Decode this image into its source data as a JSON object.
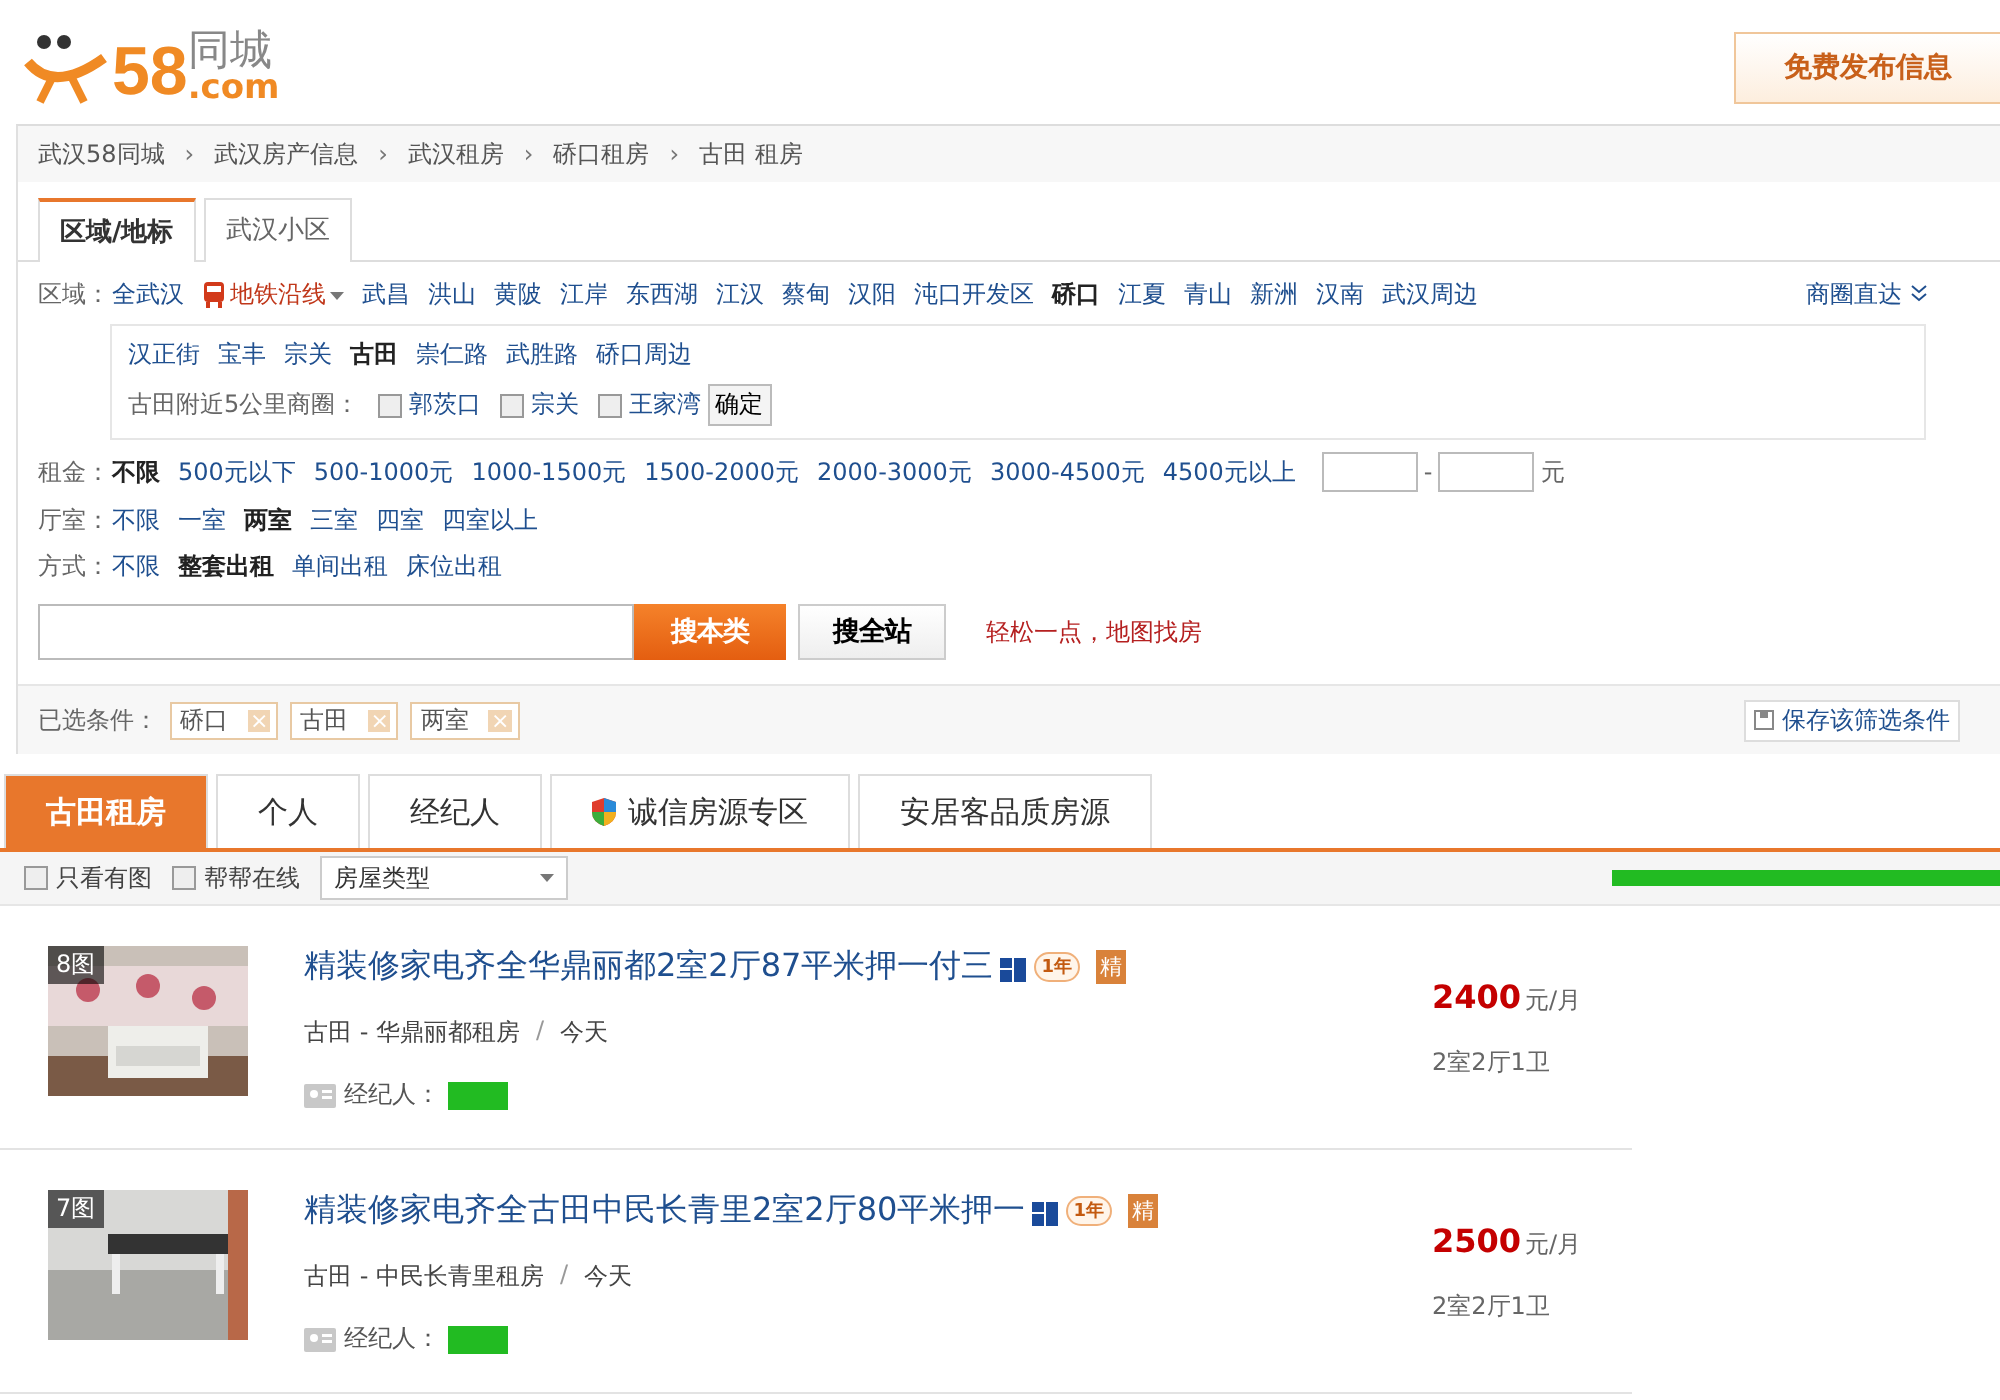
{
  "header": {
    "logo": {
      "number": "58",
      "domain": ".com",
      "name": "同城"
    },
    "publish_button": "免费发布信息"
  },
  "breadcrumb": [
    "武汉58同城",
    "武汉房产信息",
    "武汉租房",
    "硚口租房",
    "古田 租房"
  ],
  "breadcrumb_separator": "›",
  "filter_tabs": [
    {
      "label": "区域/地标",
      "selected": true
    },
    {
      "label": "武汉小区",
      "selected": false
    }
  ],
  "region": {
    "label": "区域：",
    "items": [
      {
        "label": "全武汉",
        "selected": false,
        "kind": "link"
      },
      {
        "label": "地铁沿线",
        "selected": false,
        "kind": "metro"
      },
      {
        "label": "武昌",
        "selected": false,
        "kind": "link"
      },
      {
        "label": "洪山",
        "selected": false,
        "kind": "link"
      },
      {
        "label": "黄陂",
        "selected": false,
        "kind": "link"
      },
      {
        "label": "江岸",
        "selected": false,
        "kind": "link"
      },
      {
        "label": "东西湖",
        "selected": false,
        "kind": "link"
      },
      {
        "label": "江汉",
        "selected": false,
        "kind": "link"
      },
      {
        "label": "蔡甸",
        "selected": false,
        "kind": "link"
      },
      {
        "label": "汉阳",
        "selected": false,
        "kind": "link"
      },
      {
        "label": "沌口开发区",
        "selected": false,
        "kind": "link"
      },
      {
        "label": "硚口",
        "selected": true,
        "kind": "link"
      },
      {
        "label": "江夏",
        "selected": false,
        "kind": "link"
      },
      {
        "label": "青山",
        "selected": false,
        "kind": "link"
      },
      {
        "label": "新洲",
        "selected": false,
        "kind": "link"
      },
      {
        "label": "汉南",
        "selected": false,
        "kind": "link"
      },
      {
        "label": "武汉周边",
        "selected": false,
        "kind": "link"
      }
    ],
    "shortcut": "商圈直达"
  },
  "subregion": {
    "items": [
      {
        "label": "汉正街",
        "selected": false
      },
      {
        "label": "宝丰",
        "selected": false
      },
      {
        "label": "宗关",
        "selected": false
      },
      {
        "label": "古田",
        "selected": true
      },
      {
        "label": "崇仁路",
        "selected": false
      },
      {
        "label": "武胜路",
        "selected": false
      },
      {
        "label": "硚口周边",
        "selected": false
      }
    ],
    "nearby_label": "古田附近5公里商圈：",
    "nearby": [
      {
        "label": "郭茨口",
        "checked": false
      },
      {
        "label": "宗关",
        "checked": false
      },
      {
        "label": "王家湾",
        "checked": false
      }
    ],
    "confirm": "确定"
  },
  "rent": {
    "label": "租金：",
    "items": [
      {
        "label": "不限",
        "selected": true
      },
      {
        "label": "500元以下",
        "selected": false
      },
      {
        "label": "500-1000元",
        "selected": false
      },
      {
        "label": "1000-1500元",
        "selected": false
      },
      {
        "label": "1500-2000元",
        "selected": false
      },
      {
        "label": "2000-3000元",
        "selected": false
      },
      {
        "label": "3000-4500元",
        "selected": false
      },
      {
        "label": "4500元以上",
        "selected": false
      }
    ],
    "range_dash": "-",
    "unit": "元"
  },
  "rooms": {
    "label": "厅室：",
    "items": [
      {
        "label": "不限",
        "selected": false
      },
      {
        "label": "一室",
        "selected": false
      },
      {
        "label": "两室",
        "selected": true
      },
      {
        "label": "三室",
        "selected": false
      },
      {
        "label": "四室",
        "selected": false
      },
      {
        "label": "四室以上",
        "selected": false
      }
    ]
  },
  "mode": {
    "label": "方式：",
    "items": [
      {
        "label": "不限",
        "selected": false
      },
      {
        "label": "整套出租",
        "selected": true
      },
      {
        "label": "单间出租",
        "selected": false
      },
      {
        "label": "床位出租",
        "selected": false
      }
    ]
  },
  "search": {
    "category_button": "搜本类",
    "site_button": "搜全站",
    "map_link": "轻松一点，地图找房"
  },
  "selected_conditions": {
    "label": "已选条件：",
    "tags": [
      "硚口",
      "古田",
      "两室"
    ],
    "remove": "×",
    "save": "保存该筛选条件"
  },
  "list_tabs": [
    {
      "label": "古田租房",
      "selected": true,
      "kind": "plain"
    },
    {
      "label": "个人",
      "selected": false,
      "kind": "plain"
    },
    {
      "label": "经纪人",
      "selected": false,
      "kind": "plain"
    },
    {
      "label": "诚信房源专区",
      "selected": false,
      "kind": "shield"
    },
    {
      "label": "安居客品质房源",
      "selected": false,
      "kind": "plain"
    }
  ],
  "toolbar": {
    "checkboxes": [
      {
        "label": "只看有图",
        "checked": false
      },
      {
        "label": "帮帮在线",
        "checked": false
      }
    ],
    "type_select": "房屋类型"
  },
  "listings": [
    {
      "photo_count": "8图",
      "title": "精装修家电齐全华鼎丽都2室2厅87平米押一付三",
      "years": "1年",
      "featured": "精",
      "area": "古田 - 华鼎丽都租房",
      "separator": "/",
      "date": "今天",
      "agent_label": "经纪人：",
      "price": "2400",
      "price_unit": "元/月",
      "layout": "2室2厅1卫"
    },
    {
      "photo_count": "7图",
      "title": "精装修家电齐全古田中民长青里2室2厅80平米押一",
      "years": "1年",
      "featured": "精",
      "area": "古田 - 中民长青里租房",
      "separator": "/",
      "date": "今天",
      "agent_label": "经纪人：",
      "price": "2500",
      "price_unit": "元/月",
      "layout": "2室2厅1卫"
    }
  ]
}
